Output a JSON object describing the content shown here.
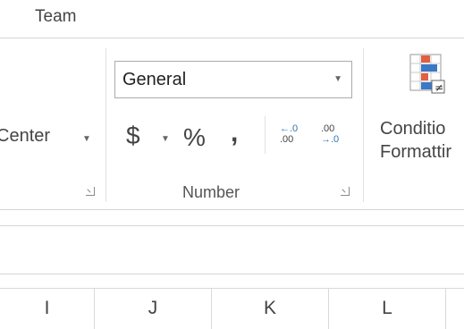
{
  "tabs": {
    "team": "Team"
  },
  "alignment": {
    "merge_center_label": "Center"
  },
  "number": {
    "format_value": "General",
    "currency_symbol": "$",
    "percent_symbol": "%",
    "comma_symbol": ",",
    "increase_decimal_top": "←.0",
    "increase_decimal_bottom": ".00",
    "decrease_decimal_top": ".00",
    "decrease_decimal_bottom": "→.0",
    "group_label": "Number"
  },
  "styles": {
    "conditional_line1": "Conditio",
    "conditional_line2": "Formattir"
  },
  "columns": [
    "I",
    "J",
    "K",
    "L"
  ],
  "icons": [
    "dropdown-caret-icon",
    "dialog-launcher-icon",
    "conditional-formatting-icon",
    "accounting-format-icon"
  ],
  "colors": {
    "accent_blue": "#2e75b6",
    "cf_red": "#e06040",
    "cf_blue": "#3b78c8"
  }
}
